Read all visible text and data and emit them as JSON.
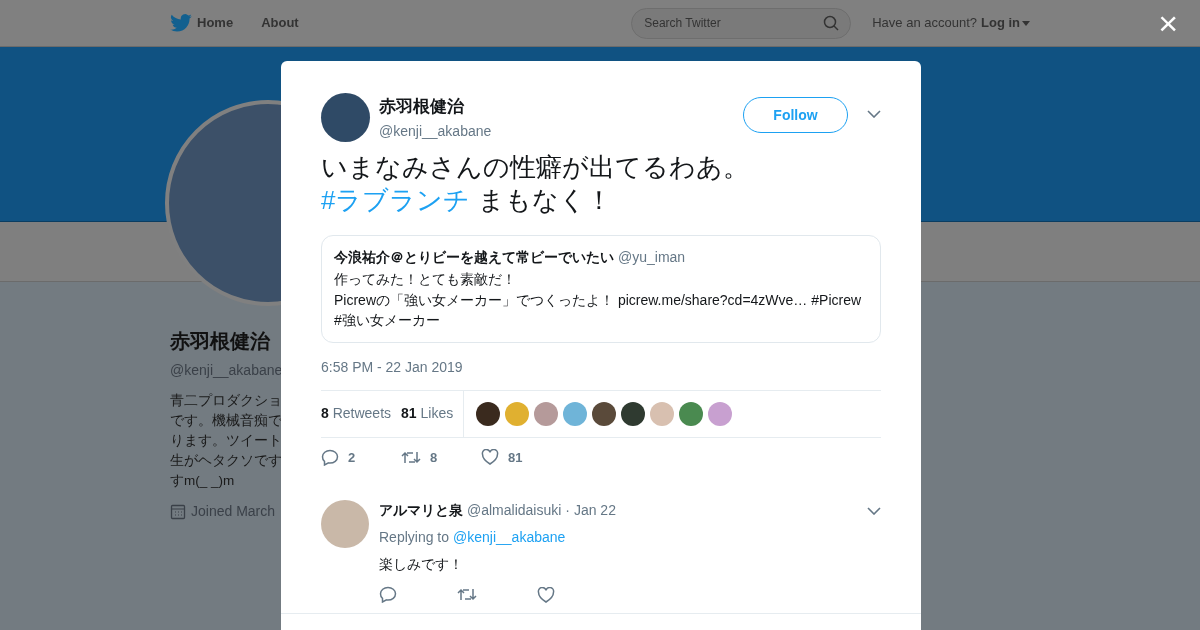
{
  "nav": {
    "home": "Home",
    "about": "About",
    "search_placeholder": "Search Twitter",
    "account_prompt": "Have an account?",
    "login": "Log in"
  },
  "profile": {
    "name": "赤羽根健治",
    "handle": "@kenji__akabane",
    "bio_lines": [
      "青二プロダクショ",
      "です。機械音痴で",
      "ります。ツイート",
      "生がヘタクソです",
      "すm(_ _)m"
    ],
    "joined": "Joined March"
  },
  "close": "×",
  "tweet": {
    "name": "赤羽根健治",
    "handle": "@kenji__akabane",
    "follow": "Follow",
    "text": [
      {
        "kind": "plain",
        "text": "いまなみさんの性癖が出てるわあ。"
      },
      {
        "kind": "hashtag",
        "text": "#ラブランチ"
      },
      {
        "kind": "plain",
        "text": " まもなく！"
      }
    ],
    "quoted": {
      "name": "今浪祐介＠とりビーを越えて常ビーでいたい",
      "handle": "@yu_iman",
      "text": "作ってみた！とても素敵だ！\nPicrewの「強い女メーカー」でつくったよ！ picrew.me/share?cd=4zWve… #Picrew #強い女メーカー"
    },
    "timestamp": "6:58 PM - 22 Jan 2019",
    "retweets_count": "8",
    "retweets_label": "Retweets",
    "likes_count": "81",
    "likes_label": "Likes",
    "likers": [
      {
        "kind": "photo"
      },
      {
        "kind": "photo"
      },
      {
        "kind": "photo"
      },
      {
        "kind": "photo"
      },
      {
        "kind": "photo"
      },
      {
        "kind": "photo"
      },
      {
        "kind": "photo"
      },
      {
        "kind": "photo"
      },
      {
        "kind": "photo"
      }
    ],
    "actions": {
      "replies": "2",
      "retweets": "8",
      "likes": "81"
    }
  },
  "replies": [
    {
      "name": "アルマリと泉",
      "handle": "@almalidaisuki",
      "date": "· Jan 22",
      "replying_to": "Replying to",
      "mention": "@kenji__akabane",
      "text": "楽しみです！"
    }
  ]
}
